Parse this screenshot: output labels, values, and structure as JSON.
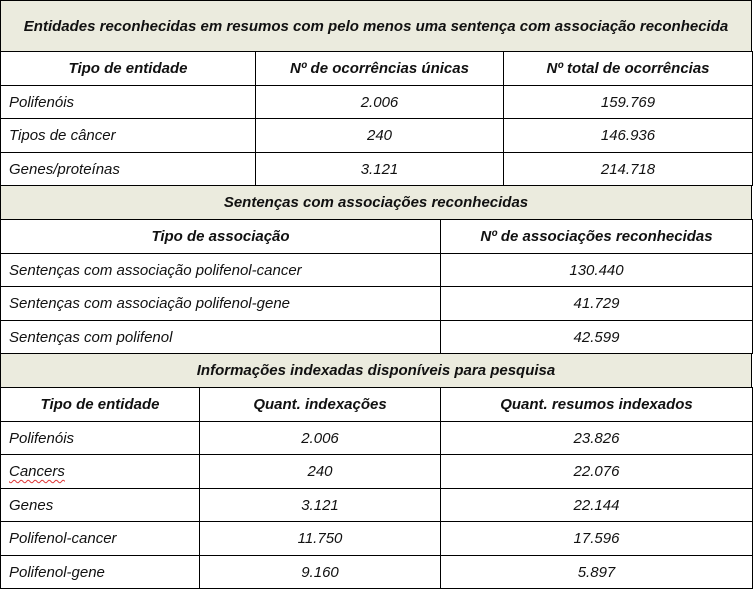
{
  "section1": {
    "title": "Entidades reconhecidas em resumos com pelo menos uma sentença com associação reconhecida",
    "headers": [
      "Tipo de entidade",
      "Nº de ocorrências únicas",
      "Nº total de ocorrências"
    ],
    "rows": [
      [
        "Polifenóis",
        "2.006",
        "159.769"
      ],
      [
        "Tipos de câncer",
        "240",
        "146.936"
      ],
      [
        "Genes/proteínas",
        "3.121",
        "214.718"
      ]
    ]
  },
  "section2": {
    "title": "Sentenças com associações reconhecidas",
    "headers": [
      "Tipo de associação",
      "Nº de associações reconhecidas"
    ],
    "rows": [
      [
        "Sentenças com associação polifenol-cancer",
        "130.440"
      ],
      [
        "Sentenças com associação polifenol-gene",
        "41.729"
      ],
      [
        "Sentenças com polifenol",
        "42.599"
      ]
    ]
  },
  "section3": {
    "title": "Informações indexadas disponíveis para pesquisa",
    "headers": [
      "Tipo de entidade",
      "Quant. indexações",
      "Quant. resumos indexados"
    ],
    "rows": [
      [
        "Polifenóis",
        "2.006",
        "23.826"
      ],
      [
        "Cancers",
        "240",
        "22.076"
      ],
      [
        "Genes",
        "3.121",
        "22.144"
      ],
      [
        "Polifenol-cancer",
        "11.750",
        "17.596"
      ],
      [
        "Polifenol-gene",
        "9.160",
        "5.897"
      ]
    ]
  }
}
